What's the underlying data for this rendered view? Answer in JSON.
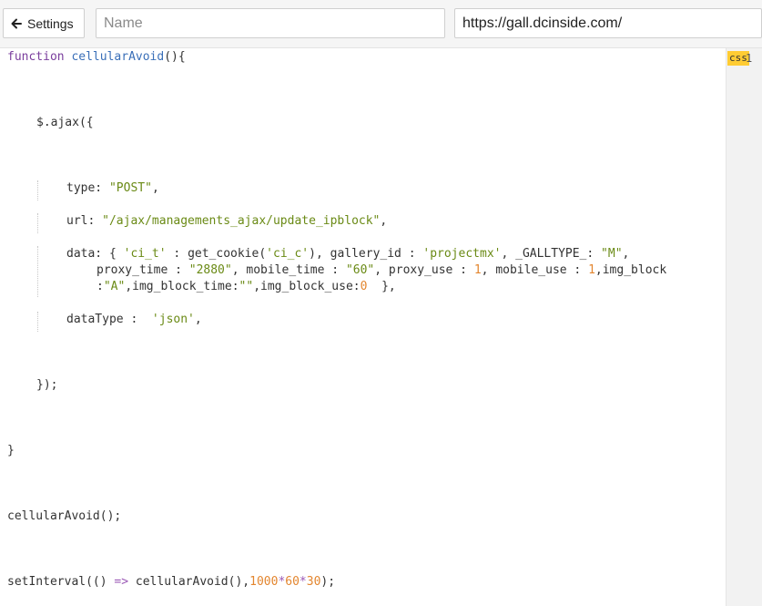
{
  "toolbar": {
    "settings_label": "Settings",
    "name_placeholder": "Name",
    "url_value": "https://gall.dcinside.com/"
  },
  "gutter": {
    "mode_badge": "css",
    "line_number": "1"
  },
  "code": {
    "l1_kw": "function",
    "l1_fn": "cellularAvoid",
    "l1_rest": "(){",
    "l2": "$.ajax({",
    "l3_key": "type: ",
    "l3_val": "\"POST\"",
    "l3_end": ",",
    "l4_key": "url: ",
    "l4_val": "\"/ajax/managements_ajax/update_ipblock\"",
    "l4_end": ",",
    "l5a_1": "data: { ",
    "l5a_2": "'ci_t'",
    "l5a_3": " : get_cookie(",
    "l5a_4": "'ci_c'",
    "l5a_5": "), gallery_id : ",
    "l5a_6": "'projectmx'",
    "l5a_7": ", _GALLTYPE_: ",
    "l5a_8": "\"M\"",
    "l5a_9": ",",
    "l5b_1": "proxy_time : ",
    "l5b_2": "\"2880\"",
    "l5b_3": ", mobile_time : ",
    "l5b_4": "\"60\"",
    "l5b_5": ", proxy_use : ",
    "l5b_6": "1",
    "l5b_7": ", mobile_use : ",
    "l5b_8": "1",
    "l5b_9": ",img_block",
    "l5c_1": ":",
    "l5c_2": "\"A\"",
    "l5c_3": ",img_block_time:",
    "l5c_4": "\"\"",
    "l5c_5": ",img_block_use:",
    "l5c_6": "0",
    "l5c_7": "  },",
    "l6_key": "dataType :  ",
    "l6_val": "'json'",
    "l6_end": ",",
    "l7": "});",
    "l8": "}",
    "l9": "cellularAvoid();",
    "l10_1": "setInterval(() ",
    "l10_2": "=>",
    "l10_3": " cellularAvoid(),",
    "l10_4": "1000",
    "l10_5": "*",
    "l10_6": "60",
    "l10_7": "*",
    "l10_8": "30",
    "l10_9": ");"
  }
}
